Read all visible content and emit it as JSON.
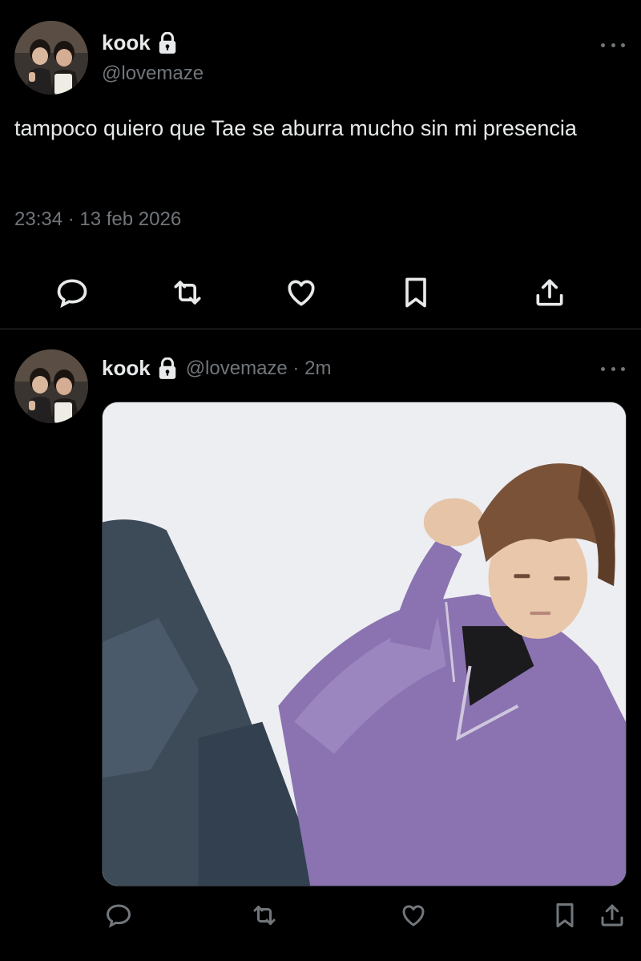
{
  "main_tweet": {
    "display_name": "kook",
    "handle": "@lovemaze",
    "text": "tampoco quiero que Tae se aburra mucho sin mi presencia",
    "timestamp": "23:34 · 13 feb 2026",
    "avatar_icon": "profile-photo",
    "locked_icon": "lock-icon",
    "actions": [
      "reply-icon",
      "retweet-icon",
      "like-icon",
      "bookmark-icon",
      "share-icon"
    ]
  },
  "reply_tweet": {
    "display_name": "kook",
    "handle_time": "@lovemaze · 2m",
    "avatar_icon": "profile-photo",
    "locked_icon": "lock-icon",
    "media_icon": "photo-attachment",
    "actions": [
      "reply-icon",
      "retweet-icon",
      "like-icon",
      "bookmark-icon",
      "share-icon"
    ]
  },
  "colors": {
    "background": "#000000",
    "text_primary": "#e7e9ea",
    "text_secondary": "#71767b",
    "divider": "#2f3336"
  }
}
